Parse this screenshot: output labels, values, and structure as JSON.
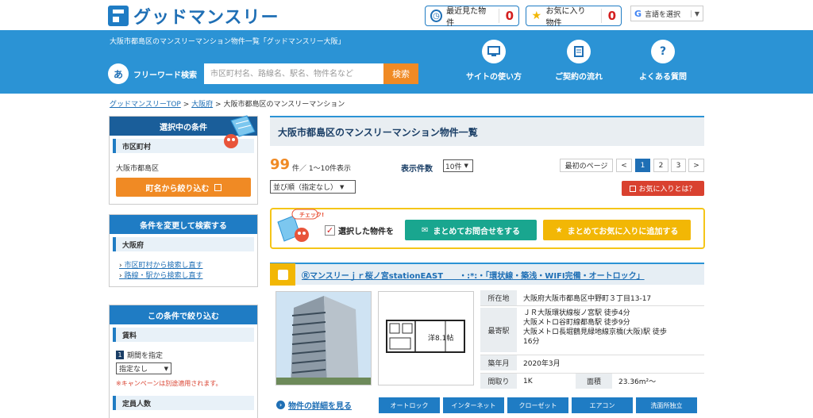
{
  "header": {
    "logo_text": "グッドマンスリー",
    "recent_label": "最近見た物件",
    "recent_count": "0",
    "fav_label": "お気に入り物件",
    "fav_count": "0",
    "translate_label": "言語を選択",
    "translate_logo": "G"
  },
  "banner": {
    "subtitle": "大阪市都島区のマンスリーマンション物件一覧「グッドマンスリー大阪」",
    "freeword_icon": "あ",
    "freeword_label": "フリーワード検索",
    "search_placeholder": "市区町村名、路線名、駅名、物件名など",
    "search_button": "検索",
    "nav": [
      {
        "label": "サイトの使い方",
        "icon": "monitor-icon"
      },
      {
        "label": "ご契約の流れ",
        "icon": "document-icon"
      },
      {
        "label": "よくある質問",
        "icon": "question-icon",
        "glyph": "?"
      }
    ]
  },
  "breadcrumb": {
    "items": [
      "グッドマンスリーTOP",
      "大阪府",
      "大阪市都島区のマンスリーマンション"
    ],
    "sep": ">"
  },
  "sidebar": {
    "selected": {
      "title": "選択中の条件",
      "sub": "市区町村",
      "value": "大阪市都島区",
      "narrow_button": "町名から絞り込む"
    },
    "change": {
      "title": "条件を変更して検索する",
      "sub": "大阪府",
      "links": [
        "市区町村から検索し直す",
        "路線・駅から検索し直す"
      ]
    },
    "filter": {
      "title": "この条件で絞り込む",
      "sub_rent": "賃料",
      "period_num": "1",
      "period_label": "期間を指定",
      "period_value": "指定なし",
      "note": "※キャンペーンは別途適用されます。",
      "sub_capacity": "定員人数"
    }
  },
  "main": {
    "title": "大阪市都島区のマンスリーマンション物件一覧",
    "count": "99",
    "count_text": "件／ 1〜10件表示",
    "display_label": "表示件数",
    "display_value": "10件",
    "sort_value": "並び順（指定なし）",
    "pager": {
      "first": "最初のページ",
      "prev": "<",
      "pages": [
        "1",
        "2",
        "3"
      ],
      "next": ">"
    },
    "fav_what": "お気に入りとは？",
    "check_badge": "チェック!",
    "select_label": "選択した物件を",
    "inquire_button": "まとめてお問合せをする",
    "favadd_button": "まとめてお気に入りに追加する"
  },
  "property": {
    "title": "Ⓡマンスリーｊｒ桜ノ宮stationEAST　　・:*:・「環状線・築浅・WIFI完備・オートロック」",
    "floorplan_label": "洋8.1帖",
    "address_label": "所在地",
    "address": "大阪府大阪市都島区中野町３丁目13-17",
    "station_label": "最寄駅",
    "station_lines": [
      "ＪＲ大阪環状線桜ノ宮駅 徒歩4分",
      "大阪メトロ谷町線都島駅 徒歩9分",
      "大阪メトロ長堀鶴見緑地線京橋(大阪)駅 徒歩",
      "16分"
    ],
    "built_label": "築年月",
    "built": "2020年3月",
    "layout_label": "間取り",
    "layout": "1K",
    "area_label": "面積",
    "area": "23.36m²〜",
    "details_link": "物件の詳細を見る",
    "features": [
      "オートロック",
      "インターネット",
      "クローゼット",
      "エアコン",
      "洗面所独立"
    ]
  },
  "colors": {
    "primary": "#1f7cc4",
    "banner": "#2b93d5",
    "accent_orange": "#f08a24",
    "green": "#19a68f",
    "yellow": "#f2b705",
    "red": "#d9412f"
  }
}
